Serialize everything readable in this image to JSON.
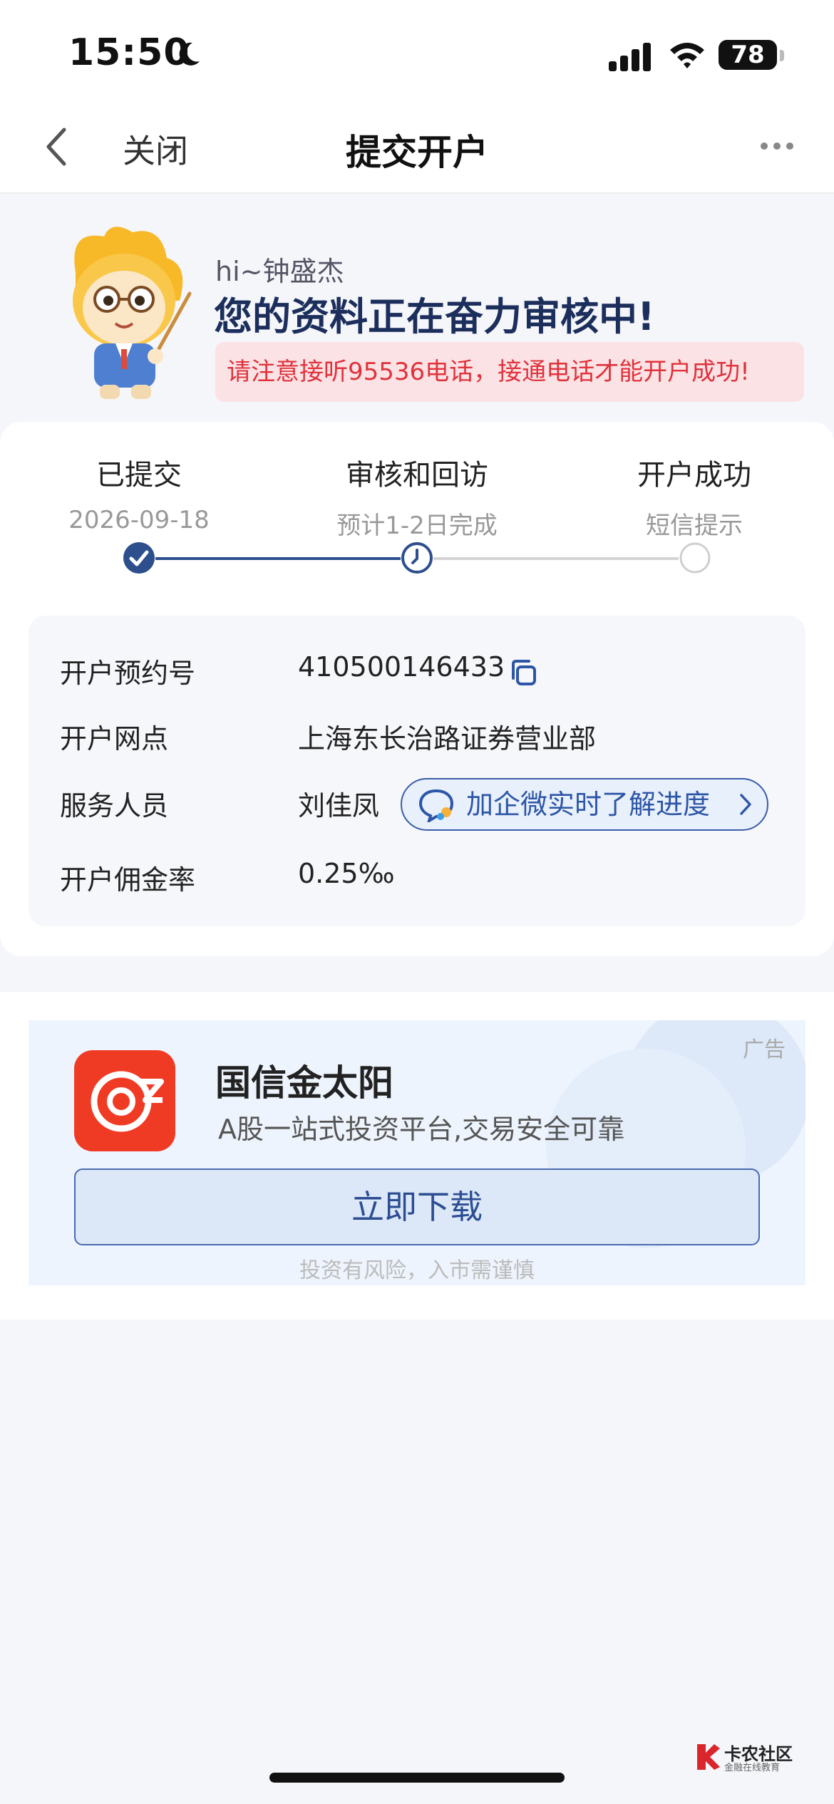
{
  "status_bar": {
    "time": "15:50",
    "battery": "78",
    "icons": [
      "moon-icon",
      "cellular-signal-icon",
      "wifi-icon",
      "battery-icon"
    ]
  },
  "nav": {
    "back_icon": "chevron-left-icon",
    "close_label": "关闭",
    "title": "提交开户",
    "more_icon": "more-dots-icon"
  },
  "hero": {
    "greeting": "hi~钟盛杰",
    "title": "您的资料正在奋力审核中!",
    "alert": "请注意接听95536电话，接通电话才能开户成功!"
  },
  "progress": {
    "steps": [
      {
        "label": "已提交",
        "sub": "2026-09-18",
        "state": "done"
      },
      {
        "label": "审核和回访",
        "sub": "预计1-2日完成",
        "state": "current"
      },
      {
        "label": "开户成功",
        "sub": "短信提示",
        "state": "pending"
      }
    ],
    "colors": {
      "done": "#2d4f8e",
      "pending": "#d0d0d0"
    }
  },
  "info": {
    "rows": [
      {
        "label": "开户预约号",
        "value": "410500146433"
      },
      {
        "label": "开户网点",
        "value": "上海东长治路证券营业部"
      },
      {
        "label": "服务人员",
        "value": "刘佳凤"
      },
      {
        "label": "开户佣金率",
        "value": "0.25‰"
      }
    ],
    "wechat_button": "加企微实时了解进度"
  },
  "ad": {
    "tag": "广告",
    "app_name": "国信金太阳",
    "tagline": "A股一站式投资平台,交易安全可靠",
    "download_label": "立即下载",
    "risk_notice": "投资有风险，入市需谨慎"
  },
  "watermark": {
    "title": "卡农社区",
    "subtitle": "金融在线教育"
  },
  "colors": {
    "brand_navy": "#1c2f5c",
    "alert_red": "#e0323c",
    "alert_bg": "#fbe3e5",
    "link_blue": "#2e56a6"
  }
}
